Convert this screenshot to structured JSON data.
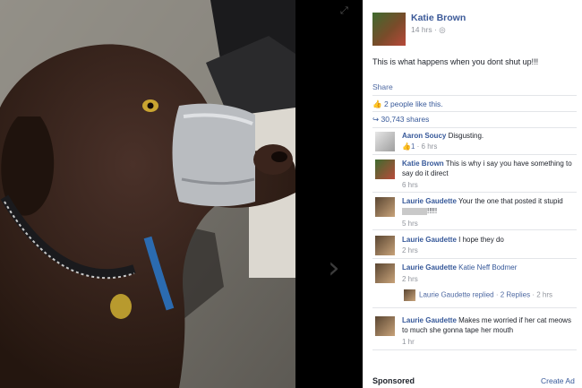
{
  "post": {
    "author": "Katie Brown",
    "time": "14 hrs",
    "privacy_icon": "globe-icon",
    "text": "This is what happens when you dont shut up!!!",
    "share": "Share",
    "likes": "2 people like this.",
    "shares": "30,743 shares"
  },
  "comments": [
    {
      "name": "Aaron Soucy",
      "text": "Disgusting.",
      "likes": "1",
      "time": "6 hrs"
    },
    {
      "name": "Katie Brown",
      "text": "This is why i say you have something to say do it direct",
      "time": "6 hrs"
    },
    {
      "name": "Laurie Gaudette",
      "text": "Your the one that posted it stupid",
      "text_tail": "!!!!!",
      "time": "5 hrs"
    },
    {
      "name": "Laurie Gaudette",
      "text": "I hope they do",
      "time": "2 hrs"
    },
    {
      "name": "Laurie Gaudette",
      "text": "Katie Neff Bodmer",
      "time": "2 hrs"
    },
    {
      "name": "Laurie Gaudette",
      "text": "Makes me worried if her cat meows to much she gonna tape her mouth",
      "time": "1 hr"
    }
  ],
  "replies": {
    "author": "Laurie Gaudette",
    "action": "replied",
    "count": "2 Replies",
    "time": "2 hrs"
  },
  "footer": {
    "sponsored": "Sponsored",
    "create_ad": "Create Ad"
  },
  "photo": {
    "subject": "brown dog with duct tape around its muzzle"
  }
}
